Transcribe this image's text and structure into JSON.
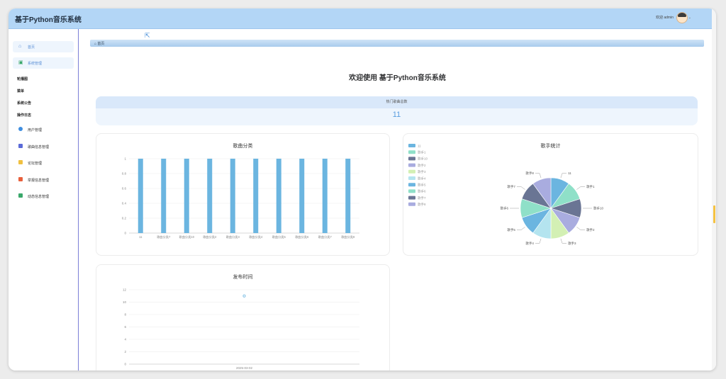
{
  "app": {
    "title": "基于Python音乐系统"
  },
  "header": {
    "user_text": "欢迎 admin",
    "caret": "⌄"
  },
  "sidebar": {
    "home": "首页",
    "system": "系统管理",
    "plain_items": [
      "轮播图",
      "菜单",
      "系统公告",
      "操作日志"
    ],
    "items": [
      {
        "label": "用户管理",
        "icon": "user-icon",
        "color": "#3f8ee0"
      },
      {
        "label": "歌曲信息管理",
        "icon": "music-icon",
        "color": "#5b6bd8"
      },
      {
        "label": "论坛管理",
        "icon": "grid-icon",
        "color": "#f0c040"
      },
      {
        "label": "举报信息管理",
        "icon": "report-icon",
        "color": "#e8603c"
      },
      {
        "label": "动态信息管理",
        "icon": "feed-icon",
        "color": "#3aa86b"
      }
    ]
  },
  "breadcrumb": {
    "home": "⌂ 首页"
  },
  "welcome": "欢迎使用 基于Python音乐系统",
  "stats": {
    "label": "热门歌曲总数",
    "value": "11"
  },
  "charts": {
    "category": {
      "title": "歌曲分类",
      "categories": [
        "11",
        "歌曲分类7",
        "歌曲分类10",
        "歌曲分类2",
        "歌曲分类3",
        "歌曲分类4",
        "歌曲分类5",
        "歌曲分类6",
        "歌曲分类7",
        "歌曲分类8"
      ],
      "values": [
        1,
        1,
        1,
        1,
        1,
        1,
        1,
        1,
        1,
        1
      ],
      "yticks": [
        "0",
        "0.2",
        "0.4",
        "0.6",
        "0.8",
        "1"
      ],
      "ylim": [
        0,
        1
      ],
      "color": "#6bb5e0"
    },
    "singer": {
      "title": "歌手统计",
      "legend": [
        "11",
        "歌手1",
        "歌手10",
        "歌手2",
        "歌手3",
        "歌手4",
        "歌手5",
        "歌手6",
        "歌手7",
        "歌手8"
      ],
      "slices": [
        {
          "label": "11",
          "value": 1,
          "color": "#6bb5e0"
        },
        {
          "label": "歌手1",
          "value": 1,
          "color": "#8fe0c8"
        },
        {
          "label": "歌手10",
          "value": 1,
          "color": "#6a7594"
        },
        {
          "label": "歌手2",
          "value": 1,
          "color": "#a9acdf"
        },
        {
          "label": "歌手3",
          "value": 1,
          "color": "#d3f0b4"
        },
        {
          "label": "歌手4",
          "value": 1,
          "color": "#b4e4ef"
        },
        {
          "label": "歌手5",
          "value": 1,
          "color": "#6bb5e0"
        },
        {
          "label": "歌手6",
          "value": 1,
          "color": "#8fe0c8"
        },
        {
          "label": "歌手7",
          "value": 1,
          "color": "#6a7594"
        },
        {
          "label": "歌手8",
          "value": 1,
          "color": "#a9acdf"
        }
      ]
    },
    "release": {
      "title": "发布时间",
      "x": [
        "2025-03-02"
      ],
      "y": [
        11
      ],
      "yticks": [
        "0",
        "2",
        "4",
        "6",
        "8",
        "10",
        "12"
      ],
      "ylim": [
        0,
        12
      ],
      "color": "#6bb5e0"
    }
  },
  "chart_data": [
    {
      "type": "bar",
      "title": "歌曲分类",
      "categories": [
        "11",
        "歌曲分类7",
        "歌曲分类10",
        "歌曲分类2",
        "歌曲分类3",
        "歌曲分类4",
        "歌曲分类5",
        "歌曲分类6",
        "歌曲分类7",
        "歌曲分类8"
      ],
      "values": [
        1,
        1,
        1,
        1,
        1,
        1,
        1,
        1,
        1,
        1
      ],
      "ylim": [
        0,
        1
      ],
      "grid": true
    },
    {
      "type": "pie",
      "title": "歌手统计",
      "categories": [
        "11",
        "歌手1",
        "歌手10",
        "歌手2",
        "歌手3",
        "歌手4",
        "歌手5",
        "歌手6",
        "歌手7",
        "歌手8"
      ],
      "values": [
        1,
        1,
        1,
        1,
        1,
        1,
        1,
        1,
        1,
        1
      ],
      "legend": "top-left"
    },
    {
      "type": "scatter",
      "title": "发布时间",
      "x": [
        "2025-03-02"
      ],
      "y": [
        11
      ],
      "ylim": [
        0,
        12
      ],
      "grid": true
    }
  ]
}
